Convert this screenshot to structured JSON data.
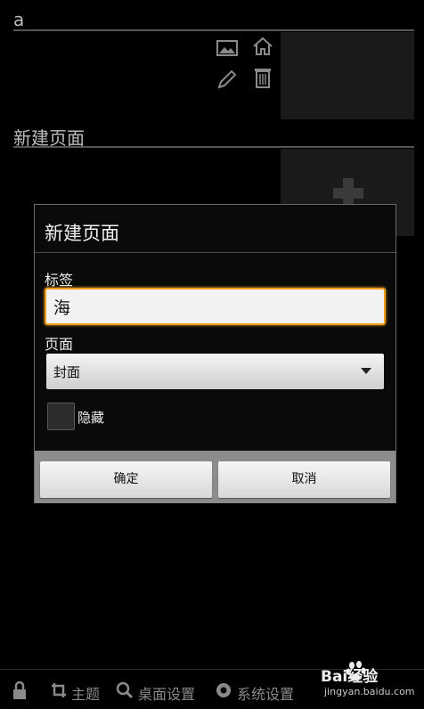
{
  "pages": [
    {
      "title": "a"
    },
    {
      "title": "新建页面"
    }
  ],
  "dialog": {
    "title": "新建页面",
    "label_field": {
      "label": "标签",
      "value": "海"
    },
    "page_field": {
      "label": "页面",
      "selected": "封面"
    },
    "hidden_checkbox": {
      "label": "隐藏",
      "checked": false
    },
    "ok_label": "确定",
    "cancel_label": "取消"
  },
  "bottom_bar": {
    "theme_label": "主题",
    "desktop_settings_label": "桌面设置",
    "system_settings_label": "系统设置"
  },
  "watermark": {
    "brand": "Bai经验",
    "sub": "jingyan.baidu.com"
  },
  "colors": {
    "accent": "#f09a1a",
    "background": "#000000"
  }
}
